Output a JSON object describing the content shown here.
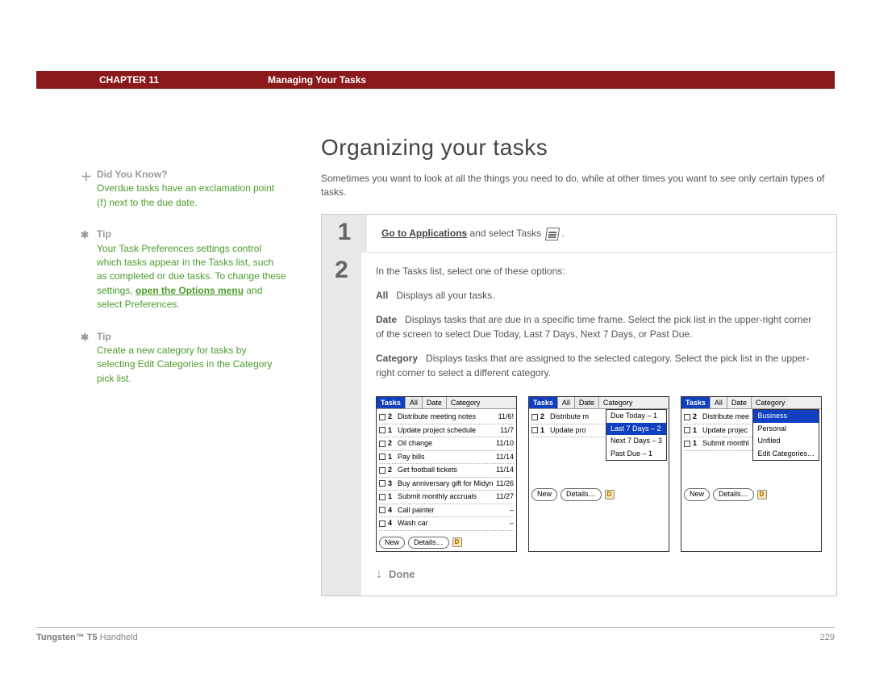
{
  "header": {
    "chapter": "CHAPTER 11",
    "section": "Managing Your Tasks"
  },
  "title": "Organizing your tasks",
  "intro": "Sometimes you want to look at all the things you need to do, while at other times you want to see only certain types of tasks.",
  "sidebar": {
    "blocks": [
      {
        "icon": "plus",
        "label": "Did You Know?",
        "text_before": "Overdue tasks have an exclamation point (",
        "bold": "!",
        "text_after": ") next to the due date."
      },
      {
        "icon": "star",
        "label": "Tip",
        "text_before": "Your Task Preferences settings control which tasks appear in the Tasks list, such as completed or due tasks. To change these settings, ",
        "link": "open the Options menu",
        "text_after": " and select Preferences."
      },
      {
        "icon": "star",
        "label": "Tip",
        "text_before": "Create a new category for tasks by selecting Edit Categories in the Category pick list.",
        "link": "",
        "text_after": ""
      }
    ]
  },
  "steps": {
    "step1": {
      "num": "1",
      "link": "Go to Applications",
      "after": " and select Tasks "
    },
    "step2": {
      "num": "2",
      "intro": "In the Tasks list, select one of these options:",
      "defs": [
        {
          "label": "All",
          "text": "Displays all your tasks."
        },
        {
          "label": "Date",
          "text": "Displays tasks that are due in a specific time frame. Select the pick list in the upper-right corner of the screen to select Due Today, Last 7 Days, Next 7 Days, or Past Due."
        },
        {
          "label": "Category",
          "text": "Displays tasks that are assigned to the selected category. Select the pick list in the upper-right corner to select a different category."
        }
      ]
    }
  },
  "done_label": "Done",
  "minis": {
    "titlebar_title": "Tasks",
    "tabs": [
      "All",
      "Date",
      "Category"
    ],
    "buttons": {
      "new": "New",
      "details": "Details…"
    },
    "all_view": {
      "selected_tab": 0,
      "rows": [
        {
          "pri": "2",
          "txt": "Distribute meeting notes",
          "date": "11/6!"
        },
        {
          "pri": "1",
          "txt": "Update project schedule",
          "date": "11/7"
        },
        {
          "pri": "2",
          "txt": "Oil change",
          "date": "11/10"
        },
        {
          "pri": "1",
          "txt": "Pay bills",
          "date": "11/14"
        },
        {
          "pri": "2",
          "txt": "Get football tickets",
          "date": "11/14"
        },
        {
          "pri": "3",
          "txt": "Buy anniversary gift for Midyne & Greg",
          "date": "11/26"
        },
        {
          "pri": "1",
          "txt": "Submit monthly accruals",
          "date": "11/27"
        },
        {
          "pri": "4",
          "txt": "Call painter",
          "date": "–"
        },
        {
          "pri": "4",
          "txt": "Wash car",
          "date": "–"
        }
      ]
    },
    "date_view": {
      "selected_tab": 1,
      "rows": [
        {
          "pri": "2",
          "txt": "Distribute m",
          "date": ""
        },
        {
          "pri": "1",
          "txt": "Update pro",
          "date": ""
        }
      ],
      "dropdown": [
        "Due Today – 1",
        "Last 7 Days – 2",
        "Next 7 Days – 3",
        "Past Due – 1"
      ],
      "dropdown_selected": 1
    },
    "cat_view": {
      "selected_tab": 2,
      "rows": [
        {
          "pri": "2",
          "txt": "Distribute mee",
          "date": ""
        },
        {
          "pri": "1",
          "txt": "Update projec",
          "date": ""
        },
        {
          "pri": "1",
          "txt": "Submit monthl",
          "date": ""
        }
      ],
      "dropdown": [
        "Business",
        "Personal",
        "Unfiled",
        "Edit Categories…"
      ],
      "dropdown_selected": 0
    }
  },
  "footer": {
    "product_bold": "Tungsten™ T5",
    "product_rest": " Handheld",
    "page": "229"
  }
}
